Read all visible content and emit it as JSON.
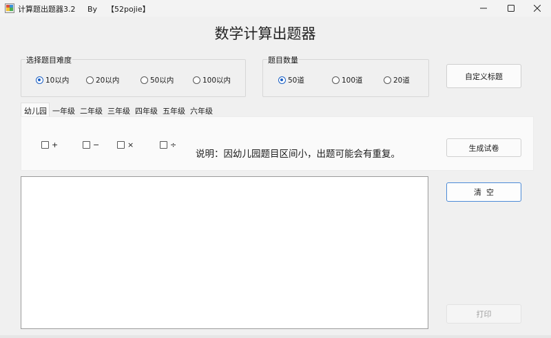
{
  "window": {
    "title": "计算题出题器3.2     By    【52pojie】",
    "controls": [
      "minimize-icon",
      "maximize-icon",
      "close-icon"
    ]
  },
  "heading": "数学计算出题器",
  "difficulty": {
    "label": "选择题目难度",
    "options": [
      "10以内",
      "20以内",
      "50以内",
      "100以内"
    ],
    "selected": "10以内"
  },
  "count": {
    "label": "题目数量",
    "options": [
      "50道",
      "100道",
      "20道"
    ],
    "selected": "50道"
  },
  "buttons": {
    "custom_title": "自定义标题",
    "generate": "生成试卷",
    "clear": "清  空",
    "print": "打印"
  },
  "tabs": [
    "幼儿园",
    "一年级",
    "二年级",
    "三年级",
    "四年级",
    "五年级",
    "六年级"
  ],
  "active_tab": "幼儿园",
  "operators": [
    "+",
    "−",
    "×",
    "÷"
  ],
  "note": "说明：因幼儿园题目区间小，出题可能会有重复。",
  "colors": {
    "accent": "#1a5fc4",
    "window_bg": "#f0f0f0",
    "panel_bg": "#fafafa"
  }
}
